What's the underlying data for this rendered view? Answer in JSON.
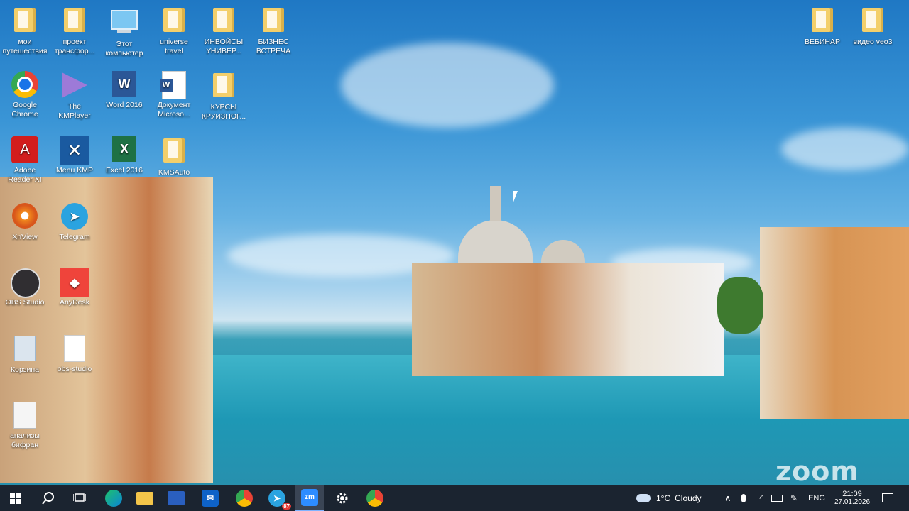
{
  "desktop": {
    "icons": [
      {
        "label": "мои путешествия",
        "icon": "folder-icon"
      },
      {
        "label": "проект трансфор...",
        "icon": "folder-icon"
      },
      {
        "label": "Этот компьютер",
        "icon": "computer-icon"
      },
      {
        "label": "universe travel",
        "icon": "folder-icon"
      },
      {
        "label": "ИНВОЙСЫ УНИВЕР...",
        "icon": "folder-icon"
      },
      {
        "label": "БИЗНЕС ВСТРЕЧА",
        "icon": "folder-icon"
      },
      {
        "label": "Google Chrome",
        "icon": "chrome-icon"
      },
      {
        "label": "The KMPlayer",
        "icon": "kmplayer-icon"
      },
      {
        "label": "Word 2016",
        "icon": "word-icon"
      },
      {
        "label": "Документ Microso...",
        "icon": "word-doc-icon"
      },
      {
        "label": "КУРСЫ КРУИЗНОГ...",
        "icon": "folder-icon"
      },
      {
        "label": "Adobe Reader XI",
        "icon": "adobe-reader-icon"
      },
      {
        "label": "Menu KMP",
        "icon": "kmp-menu-icon"
      },
      {
        "label": "Excel 2016",
        "icon": "excel-icon"
      },
      {
        "label": "KMSAuto",
        "icon": "folder-icon"
      },
      {
        "label": "XnView",
        "icon": "xnview-icon"
      },
      {
        "label": "Telegram",
        "icon": "telegram-icon"
      },
      {
        "label": "OBS Studio",
        "icon": "obs-icon"
      },
      {
        "label": "AnyDesk",
        "icon": "anydesk-icon"
      },
      {
        "label": "Корзина",
        "icon": "recycle-bin-icon"
      },
      {
        "label": "obs-studio",
        "icon": "file-icon"
      },
      {
        "label": "анализы бифран",
        "icon": "document-icon"
      },
      {
        "label": "ВЕБИНАР",
        "icon": "folder-icon"
      },
      {
        "label": "видео veo3",
        "icon": "folder-icon"
      }
    ],
    "watermark": "zoom"
  },
  "taskbar": {
    "weather": {
      "temp": "1°C",
      "condition": "Cloudy"
    },
    "language": "ENG",
    "time": "21:09",
    "date": "27.01.2026",
    "telegram_badge": "87",
    "zoom_label": "zm"
  }
}
